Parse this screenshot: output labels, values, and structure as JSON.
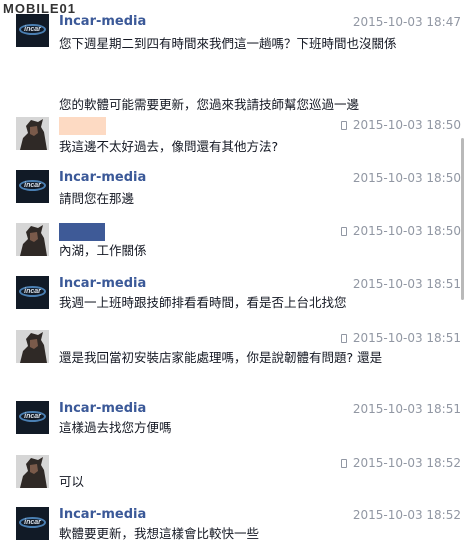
{
  "watermark": "MOBILE01",
  "messages": [
    {
      "sender": "Incar-media",
      "time": "2015-10-03 18:47",
      "lines": [
        "您下週星期二到四有時間來我們這一趟嗎？下班時間也沒關係",
        "您的軟體可能需要更新，您過來我請技師幫您巡過一邊"
      ]
    },
    {
      "sender": "",
      "time": "2015-10-03 18:50",
      "lines": [
        "我這邊不太好過去，像問還有其他方法?"
      ]
    },
    {
      "sender": "Incar-media",
      "time": "2015-10-03 18:50",
      "lines": [
        "請問您在那邊"
      ]
    },
    {
      "sender": "",
      "time": "2015-10-03 18:50",
      "lines": [
        "內湖，工作關係"
      ]
    },
    {
      "sender": "Incar-media",
      "time": "2015-10-03 18:51",
      "lines": [
        "我週一上班時跟技師排看看時間，看是否上台北找您"
      ]
    },
    {
      "sender": "",
      "time": "2015-10-03 18:51",
      "lines": [
        "還是我回當初安裝店家能處理嗎，你是說韌體有問題? 還是"
      ]
    },
    {
      "sender": "Incar-media",
      "time": "2015-10-03 18:51",
      "lines": [
        "這樣過去找您方便嗎"
      ]
    },
    {
      "sender": "",
      "time": "2015-10-03 18:52",
      "lines": [
        "可以"
      ]
    },
    {
      "sender": "Incar-media",
      "time": "2015-10-03 18:52",
      "lines": [
        "軟體要更新，我想這樣會比較快一些"
      ]
    }
  ],
  "incar_logo_text": "incar",
  "colors": {
    "sender_link": "#3b5998",
    "timestamp": "#9197a3",
    "name_redact_peach": "#fddac3",
    "name_redact_blue": "#3e5a97"
  }
}
